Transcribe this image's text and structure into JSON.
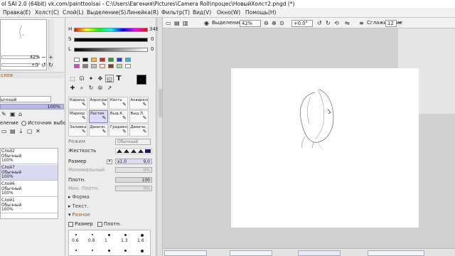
{
  "title": "ol SAI 2.0 (64bit) vk.com/painttoolsai - C:\\Users\\Евгения\\Pictures\\Camera Roll\\процес\\НовыйХолст2.pngd (*)",
  "menu": [
    "Правка(E)",
    "Холст(C)",
    "Слой(L)",
    "Выделение(S)",
    "Линейка(R)",
    "Фильтр(T)",
    "Вид(V)",
    "Окно(W)",
    "Помощь(H)"
  ],
  "left": {
    "zoom_value": "42%",
    "angle_value": "+0°",
    "layer_label": "слоя",
    "blend_mode": "ычный",
    "opacity": "100%",
    "selection_label": "еление",
    "source_label": "Источник выбора",
    "layers": [
      {
        "name": "Слой2",
        "mode": "Обычный",
        "opacity": "100%"
      },
      {
        "name": "Слой7",
        "mode": "Обычный",
        "opacity": "100%"
      },
      {
        "name": "Слой6",
        "mode": "Обычный",
        "opacity": "100%"
      },
      {
        "name": "Слой1",
        "mode": "Обычный",
        "opacity": "100%"
      }
    ]
  },
  "color": {
    "h_label": "H",
    "h_value": "348",
    "s_label": "S",
    "s_value": "0",
    "v_label": "L",
    "v_value": "0",
    "swatches": [
      "#ffffff",
      "#000000",
      "#f0c020",
      "#e02020",
      "#20a020",
      "#2040e0",
      "#20c0e0",
      "#e040c0",
      "#808080",
      "#c0c0c0",
      "#ffe0c0",
      "#804020",
      "#a0e0a0",
      "#ffffff"
    ]
  },
  "brushes": [
    {
      "label": "Каранд.",
      "sel": false
    },
    {
      "label": "Аэрограф",
      "sel": false
    },
    {
      "label": "Кисть",
      "sel": false
    },
    {
      "label": "Акварель",
      "sel": false
    },
    {
      "label": "Маркер",
      "sel": false
    },
    {
      "label": "Ластик",
      "sel": true
    },
    {
      "label": "Выд.К.",
      "sel": false
    },
    {
      "label": "Выд.Л.",
      "sel": false
    },
    {
      "label": "Заливка",
      "sel": false
    },
    {
      "label": "Двоичн.",
      "sel": false
    },
    {
      "label": "Градиент",
      "sel": false
    },
    {
      "label": "Двоичн.",
      "sel": false
    }
  ],
  "props": {
    "mode_label": "Режим",
    "mode_value": "Обычный",
    "hardness_label": "Жесткость",
    "size_label": "Размер",
    "size_mult": "x1.0",
    "size_value": "9,0",
    "min_label": "Минимальный",
    "min_value": "0%",
    "density_label": "Плотн.",
    "density_value": "100",
    "min_density_label": "Мин. Плотн.",
    "min_density_value": "0%",
    "form_label": "Форма",
    "texture_label": "Текст.",
    "misc_label": "Разное",
    "check_size": "Размер",
    "check_density": "Плотн.",
    "sizes": [
      "0.6",
      "0.8",
      "1",
      "1.3",
      "1.6"
    ]
  },
  "toolbar": {
    "selection_label": "Выделение",
    "zoom": "42%",
    "angle": "+0.0°",
    "smoothing_label": "Сглаживание",
    "smoothing_value": "12"
  }
}
